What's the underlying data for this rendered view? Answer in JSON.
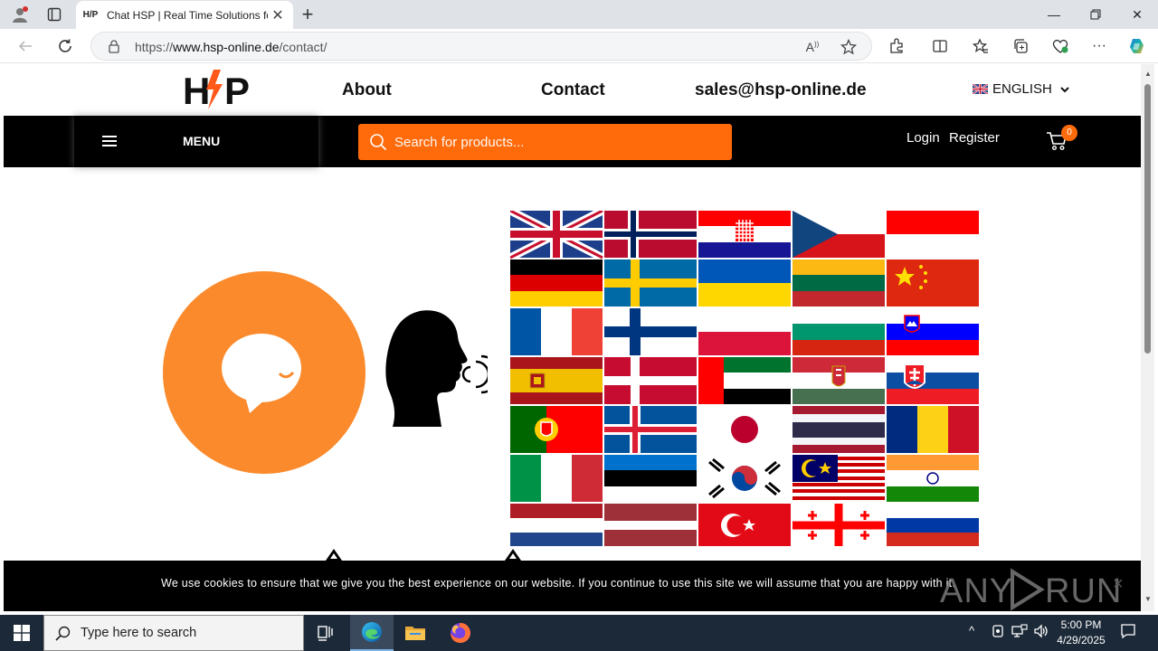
{
  "browser": {
    "tab_title": "Chat HSP | Real Time Solutions fo",
    "tab_favicon_text": "H/P",
    "url_prefix": "https://",
    "url_host": "www.hsp-online.de",
    "url_path": "/contact/"
  },
  "site": {
    "logo_text": "HSP",
    "nav": {
      "about": "About",
      "contact": "Contact",
      "email": "sales@hsp-online.de"
    },
    "language": "ENGLISH",
    "menu_label": "MENU",
    "search_placeholder": "Search for products...",
    "login": "Login",
    "register": "Register",
    "cart_count": "0"
  },
  "cookie": {
    "text": "We use cookies to ensure that we give you the best experience on our website. If you continue to use this site we will assume that you are happy with it.",
    "close": "×"
  },
  "watermark": "ANY RUN",
  "taskbar": {
    "search_placeholder": "Type here to search",
    "time": "5:00 PM",
    "date": "4/29/2025"
  },
  "colors": {
    "brand_orange": "#ff6a0b",
    "logo_bolt": "#ff5a1a",
    "chat_orange": "#fb8a2c"
  }
}
